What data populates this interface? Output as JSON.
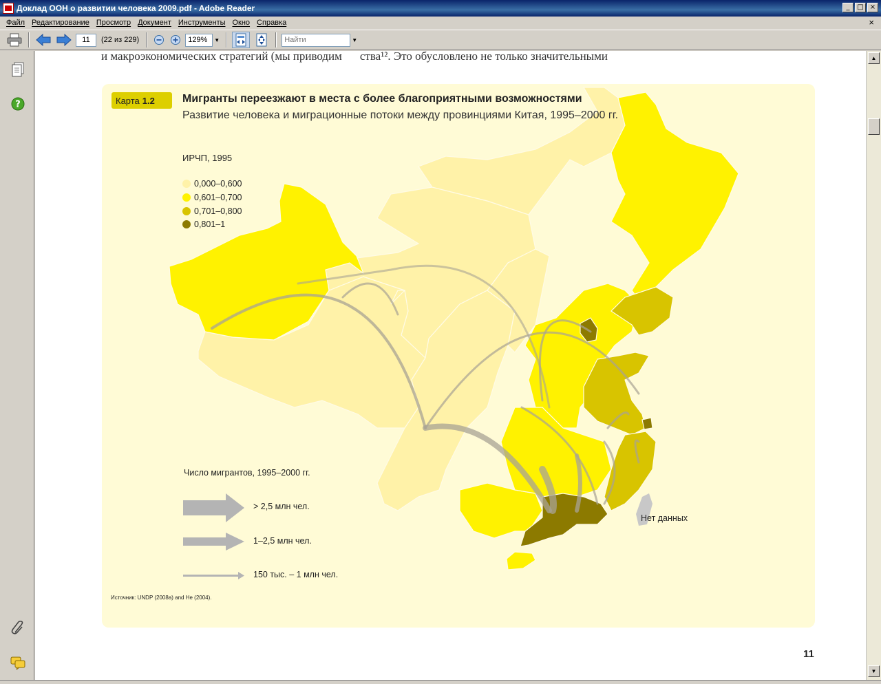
{
  "window": {
    "title": "Доклад ООН о развитии человека 2009.pdf - Adobe Reader",
    "minimize": "_",
    "maximize": "□",
    "close": "×",
    "close_doc": "×"
  },
  "menu": [
    {
      "label": "Файл"
    },
    {
      "label": "Редактирование"
    },
    {
      "label": "Просмотр"
    },
    {
      "label": "Документ"
    },
    {
      "label": "Инструменты"
    },
    {
      "label": "Окно"
    },
    {
      "label": "Справка"
    }
  ],
  "toolbar": {
    "page_value": "11",
    "page_info": "(22 из 229)",
    "zoom_value": "129%",
    "search_placeholder": "Найти"
  },
  "document": {
    "cut_text_left": "и макроэкономических стратегий (мы приводим",
    "cut_text_right": "ства¹². Это обусловлено не только значительными",
    "map_label": "Карта",
    "map_number": "1.2",
    "map_title": "Мигранты переезжают в места с более благоприятными возможностями",
    "map_subtitle": "Развитие человека и миграционные потоки между провинциями Китая, 1995–2000 гг.",
    "hdi_legend_title": "ИРЧП, 1995",
    "hdi_legend": [
      {
        "label": "0,000–0,600",
        "color": "#fff2a8"
      },
      {
        "label": "0,601–0,700",
        "color": "#fff200"
      },
      {
        "label": "0,701–0,800",
        "color": "#d8c400"
      },
      {
        "label": "0,801–1",
        "color": "#8c7a00"
      }
    ],
    "migrants_legend_title": "Число мигрантов, 1995–2000 гг.",
    "migrants_legend": [
      {
        "label": "> 2,5 млн чел."
      },
      {
        "label": "1–2,5 млн чел."
      },
      {
        "label": "150 тыс. – 1 млн чел."
      }
    ],
    "no_data": "Нет данных",
    "source_label": "Источник:",
    "source_text": "UNDP (2008a) and He (2004).",
    "page_number": "11"
  },
  "colors": {
    "panel_bg": "#fffbd6",
    "badge": "#ddcf00",
    "arrow": "#a8a394",
    "no_data": "#c8c8c8"
  }
}
